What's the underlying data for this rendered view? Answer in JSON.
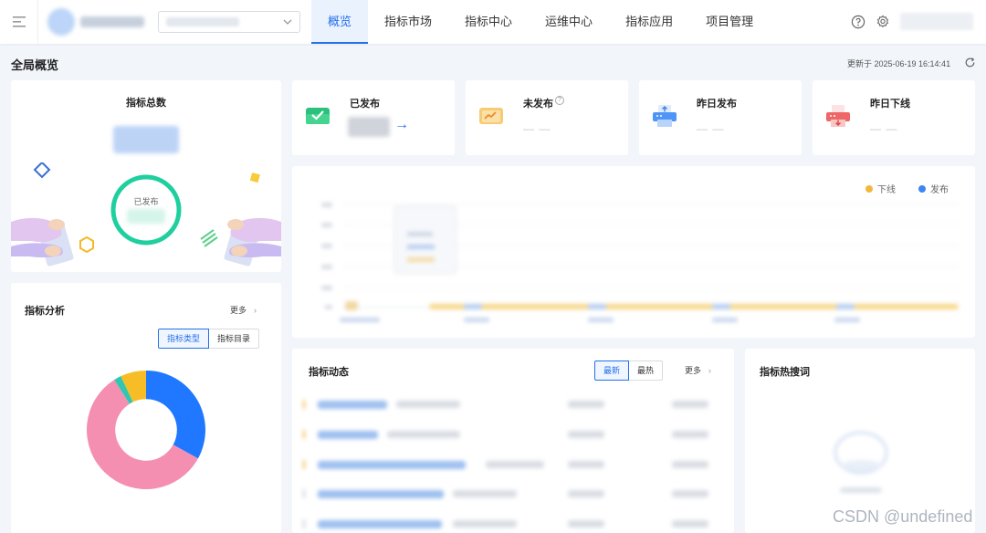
{
  "header": {
    "nav_tabs": [
      {
        "label": "概览",
        "active": true
      },
      {
        "label": "指标市场",
        "active": false
      },
      {
        "label": "指标中心",
        "active": false
      },
      {
        "label": "运维中心",
        "active": false
      },
      {
        "label": "指标应用",
        "active": false
      },
      {
        "label": "项目管理",
        "active": false
      }
    ]
  },
  "page": {
    "title": "全局概览",
    "updated": "更新于 2025-06-19 16:14:41"
  },
  "total_card": {
    "title": "指标总数",
    "ring_label": "已发布"
  },
  "stats": [
    {
      "label": "已发布",
      "value": "",
      "icon": "envelope-check-icon",
      "arrow": "→"
    },
    {
      "label": "未发布",
      "value": "— —",
      "icon": "envelope-chart-icon",
      "help": "?"
    },
    {
      "label": "昨日发布",
      "value": "— —",
      "icon": "printer-upload-icon"
    },
    {
      "label": "昨日下线",
      "value": "— —",
      "icon": "printer-download-icon"
    }
  ],
  "trend_chart": {
    "legend": [
      "下线",
      "发布"
    ]
  },
  "analysis": {
    "title": "指标分析",
    "more": "更多",
    "toggle": [
      "指标类型",
      "指标目录"
    ]
  },
  "feed": {
    "title": "指标动态",
    "toggle": [
      "最新",
      "最热"
    ],
    "more": "更多"
  },
  "hot": {
    "title": "指标热搜词"
  },
  "chart_data": {
    "type": "pie",
    "slices": [
      {
        "value": 33,
        "color": "#1f78ff"
      },
      {
        "value": 58,
        "color": "#f48fb1"
      },
      {
        "value": 2,
        "color": "#2fc7b0"
      },
      {
        "value": 7,
        "color": "#f7bd26"
      }
    ],
    "inner_radius_ratio": 0.52,
    "title": "",
    "labels": []
  },
  "watermark": "CSDN @undefined",
  "colors": {
    "accent": "#2470ea",
    "publish": "#3d86f2",
    "offline": "#f5b63c",
    "ring": "#1fcf9f"
  }
}
